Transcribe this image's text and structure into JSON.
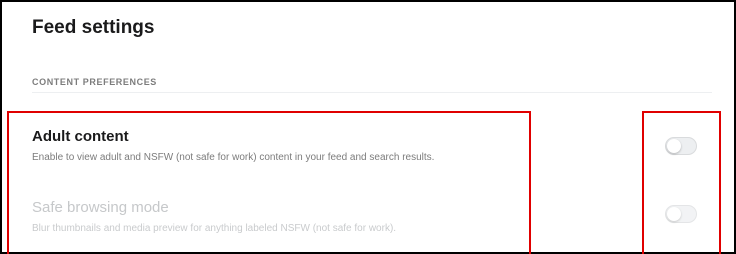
{
  "page": {
    "title": "Feed settings"
  },
  "section": {
    "header": "CONTENT PREFERENCES"
  },
  "settings": [
    {
      "title": "Adult content",
      "description": "Enable to view adult and NSFW (not safe for work) content in your feed and search results.",
      "enabled": false,
      "disabled": false
    },
    {
      "title": "Safe browsing mode",
      "description": "Blur thumbnails and media preview for anything labeled NSFW (not safe for work).",
      "enabled": false,
      "disabled": true
    }
  ],
  "colors": {
    "highlight": "#e00000",
    "frame": "#000000",
    "title_text": "#1a1a1b",
    "muted_text": "#7c7c7c",
    "disabled_text": "#c6c8ca",
    "toggle_off": "#edeff1"
  }
}
